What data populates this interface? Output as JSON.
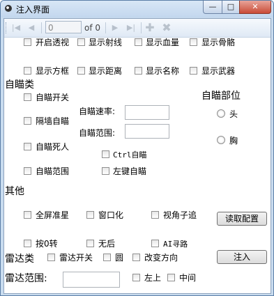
{
  "window": {
    "title": "注入界面",
    "min": "—",
    "max": "□",
    "close": "✕"
  },
  "toolbar": {
    "page_value": "0",
    "of_label": "of 0"
  },
  "esp": {
    "row1": [
      "开启透视",
      "显示射线",
      "显示血量",
      "显示骨骼"
    ],
    "row2": [
      "显示方框",
      "显示距离",
      "显示名称",
      "显示武器"
    ]
  },
  "aim": {
    "section_label": "自瞄类",
    "aim_toggle": "自瞄开关",
    "aim_wall": "隔墙自瞄",
    "aim_dead": "自瞄死人",
    "aim_range_cb": "自瞄范围",
    "ctrl_aim": "Ctrl自瞄",
    "left_aim": "左键自瞄",
    "speed_label": "自瞄速率:",
    "speed_value": "",
    "range_label": "自瞄范围:",
    "range_value": "",
    "part_label": "自瞄部位",
    "part_head": "头",
    "part_chest": "胸"
  },
  "other": {
    "section_label": "其他",
    "row1": [
      "全屏准星",
      "窗口化",
      "视角子追"
    ],
    "row2": [
      "按0转",
      "无后",
      "AI寻路"
    ],
    "read_config": "读取配置",
    "inject": "注入"
  },
  "radar": {
    "section_label": "雷达类",
    "radar_toggle": "雷达开关",
    "circle": "圆",
    "change_dir": "改变方向",
    "range_label": "雷达范围:",
    "range_value": "",
    "top_left": "左上",
    "center": "中间"
  }
}
